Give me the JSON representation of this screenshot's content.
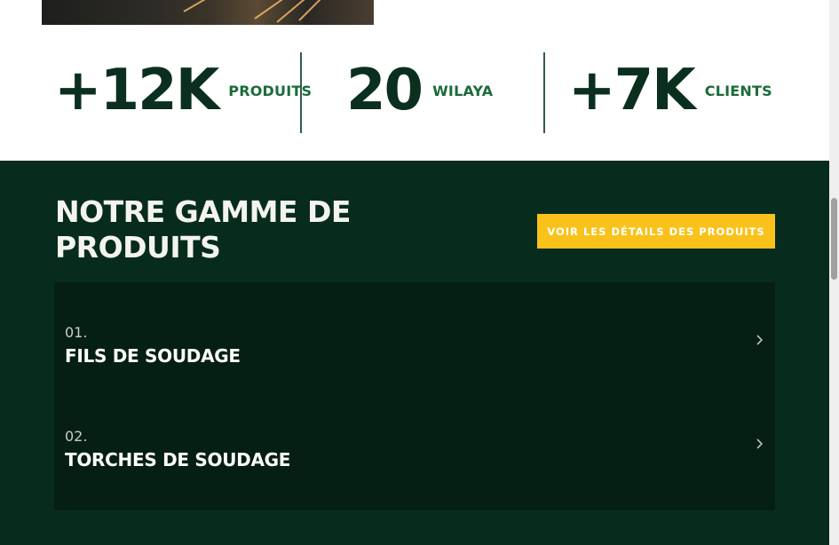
{
  "stats": [
    {
      "value": "+12K",
      "label": "PRODUITS"
    },
    {
      "value": "20",
      "label": "WILAYA"
    },
    {
      "value": "+7K",
      "label": "CLIENTS"
    }
  ],
  "products_section": {
    "title_line1": "NOTRE GAMME DE",
    "title_line2": "PRODUITS",
    "cta_label": "VOIR LES DÉTAILS DES PRODUITS",
    "items": [
      {
        "index": "01.",
        "name": "FILS DE SOUDAGE",
        "icon": "chevron-right-icon"
      },
      {
        "index": "02.",
        "name": "TORCHES DE SOUDAGE",
        "icon": "chevron-right-icon"
      }
    ]
  },
  "colors": {
    "dark_green": "#072c1d",
    "panel_green": "#051f14",
    "stat_number": "#0a2f1f",
    "stat_label": "#1b6b3a",
    "accent_yellow": "#f9c21b"
  }
}
